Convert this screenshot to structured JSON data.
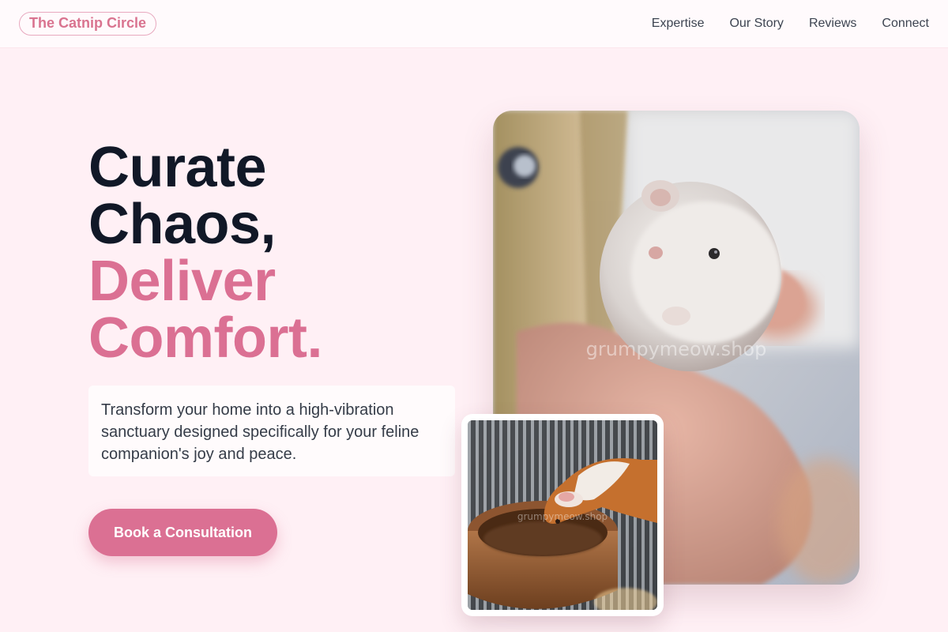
{
  "header": {
    "logo": "The Catnip Circle",
    "nav": [
      "Expertise",
      "Our Story",
      "Reviews",
      "Connect"
    ]
  },
  "hero": {
    "headline_line1": "Curate",
    "headline_line2": "Chaos,",
    "headline_line3": "Deliver",
    "headline_line4": "Comfort.",
    "description": "Transform your home into a high-vibration sanctuary designed specifically for your feline companion's joy and peace.",
    "cta_label": "Book a Consultation"
  },
  "images": {
    "main": {
      "subject": "hamster-held-in-hand-photo",
      "watermark": "grumpymeow.shop"
    },
    "secondary": {
      "subject": "guinea-pig-drinking-from-bowl-photo",
      "watermark": "grumpymeow.shop"
    }
  },
  "colors": {
    "accent": "#db7093",
    "background": "#fff0f5",
    "headline_dark": "#111827"
  }
}
